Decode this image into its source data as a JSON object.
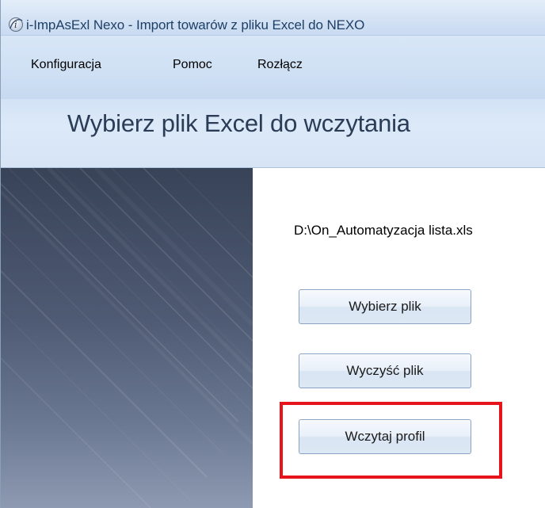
{
  "window": {
    "title": "i-ImpAsExl Nexo - Import towarów z pliku Excel do NEXO"
  },
  "menu": {
    "items": [
      {
        "label": "Konfiguracja"
      },
      {
        "label": "Pomoc"
      },
      {
        "label": "Rozłącz"
      }
    ]
  },
  "header": {
    "title": "Wybierz plik Excel do wczytania"
  },
  "content": {
    "file_path": "D:\\On_Automatyzacja lista.xls",
    "buttons": {
      "choose_file": "Wybierz plik",
      "clear_file": "Wyczyść plik",
      "load_profile": "Wczytaj profil"
    }
  },
  "colors": {
    "highlight": "#e8141c",
    "header_background": "#d6e4f6",
    "side_panel_dark": "#384358"
  },
  "icons": {
    "app": "app-logo-icon"
  }
}
